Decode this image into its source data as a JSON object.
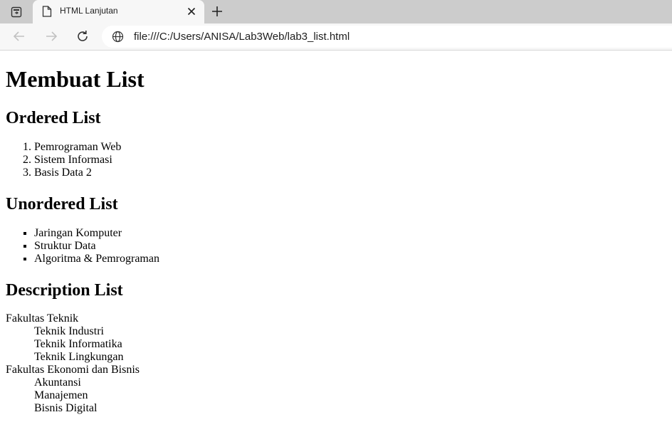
{
  "browser": {
    "tab": {
      "title": "HTML Lanjutan"
    },
    "address": {
      "url": "file:///C:/Users/ANISA/Lab3Web/lab3_list.html"
    },
    "icons": {
      "tab_actions": "tab-actions-icon",
      "favicon": "document-icon",
      "close": "close-icon",
      "new_tab": "plus-icon",
      "back": "arrow-left-icon",
      "forward": "arrow-right-icon",
      "reload": "reload-icon",
      "site_info": "globe-icon"
    }
  },
  "page": {
    "title": "Membuat List",
    "ordered": {
      "heading": "Ordered List",
      "items": [
        "Pemrograman Web",
        "Sistem Informasi",
        "Basis Data 2"
      ]
    },
    "unordered": {
      "heading": "Unordered List",
      "items": [
        "Jaringan Komputer",
        "Struktur Data",
        "Algoritma & Pemrograman"
      ]
    },
    "description": {
      "heading": "Description List",
      "groups": [
        {
          "term": "Fakultas Teknik",
          "details": [
            "Teknik Industri",
            "Teknik Informatika",
            "Teknik Lingkungan"
          ]
        },
        {
          "term": "Fakultas Ekonomi dan Bisnis",
          "details": [
            "Akuntansi",
            "Manajemen",
            "Bisnis Digital"
          ]
        }
      ]
    }
  }
}
